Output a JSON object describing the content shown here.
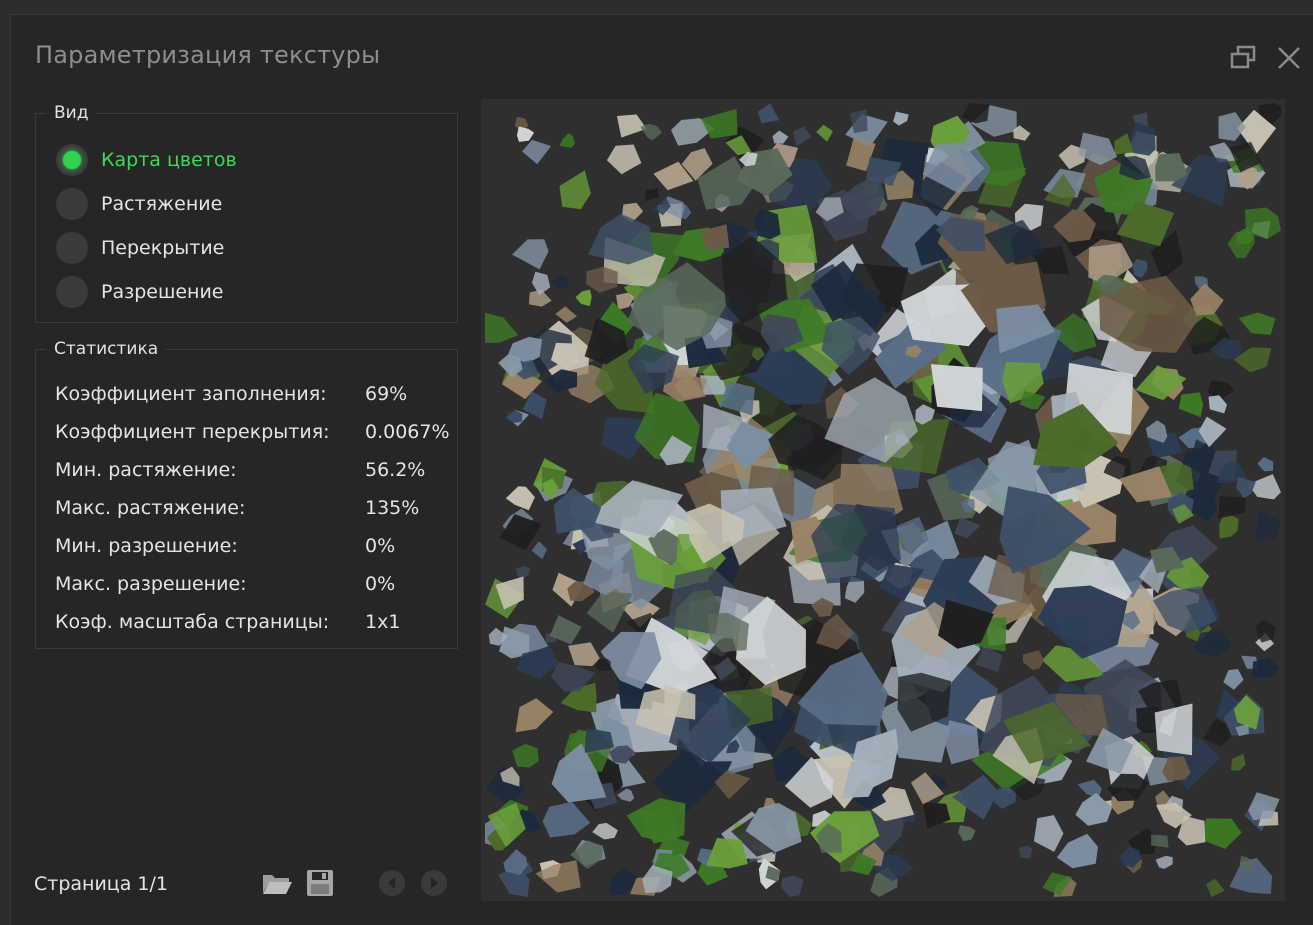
{
  "window": {
    "title": "Параметризация текстуры",
    "buttons": {
      "restore_icon": "restore-window-icon",
      "close_icon": "close-icon"
    }
  },
  "view": {
    "legend": "Вид",
    "options": [
      {
        "label": "Карта цветов",
        "checked": true
      },
      {
        "label": "Растяжение",
        "checked": false
      },
      {
        "label": "Перекрытие",
        "checked": false
      },
      {
        "label": "Разрешение",
        "checked": false
      }
    ]
  },
  "stats": {
    "legend": "Статистика",
    "rows": [
      {
        "label": "Коэффициент заполнения:",
        "value": "69%"
      },
      {
        "label": "Коэффициент перекрытия:",
        "value": "0.0067%"
      },
      {
        "label": "Мин. растяжение:",
        "value": "56.2%"
      },
      {
        "label": "Макс. растяжение:",
        "value": "135%"
      },
      {
        "label": "Мин. разрешение:",
        "value": "0%"
      },
      {
        "label": "Макс. разрешение:",
        "value": "0%"
      },
      {
        "label": "Коэф. масштаба страницы:",
        "value": "1x1"
      }
    ]
  },
  "footer": {
    "page": "Страница 1/1",
    "tools": [
      "open-folder-icon",
      "save-icon",
      "previous-page-icon",
      "next-page-icon"
    ]
  },
  "preview": {
    "palette": [
      "#1c2a3d",
      "#2c3c55",
      "#3e5068",
      "#5a6e88",
      "#7d8ea3",
      "#a7b1bc",
      "#c8c2b2",
      "#9a8466",
      "#6b5a47",
      "#4c6b2a",
      "#3d7a25",
      "#6aa03a",
      "#1f1f1f",
      "#8a9aa8",
      "#d2d6d8",
      "#596a5a",
      "#40485a",
      "#b0a08a"
    ]
  },
  "colors": {
    "accent": "#31d24d",
    "background": "#262626",
    "text": "#e4e4e4",
    "title": "#8d8d8d"
  }
}
